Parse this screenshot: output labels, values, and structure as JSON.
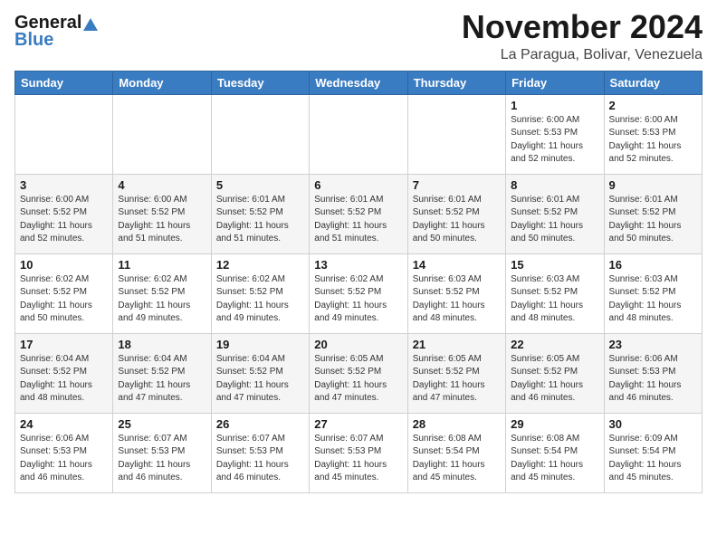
{
  "header": {
    "logo": {
      "general": "General",
      "blue": "Blue"
    },
    "title": "November 2024",
    "location": "La Paragua, Bolivar, Venezuela"
  },
  "weekdays": [
    "Sunday",
    "Monday",
    "Tuesday",
    "Wednesday",
    "Thursday",
    "Friday",
    "Saturday"
  ],
  "weeks": [
    [
      {
        "day": "",
        "info": ""
      },
      {
        "day": "",
        "info": ""
      },
      {
        "day": "",
        "info": ""
      },
      {
        "day": "",
        "info": ""
      },
      {
        "day": "",
        "info": ""
      },
      {
        "day": "1",
        "info": "Sunrise: 6:00 AM\nSunset: 5:53 PM\nDaylight: 11 hours\nand 52 minutes."
      },
      {
        "day": "2",
        "info": "Sunrise: 6:00 AM\nSunset: 5:53 PM\nDaylight: 11 hours\nand 52 minutes."
      }
    ],
    [
      {
        "day": "3",
        "info": "Sunrise: 6:00 AM\nSunset: 5:52 PM\nDaylight: 11 hours\nand 52 minutes."
      },
      {
        "day": "4",
        "info": "Sunrise: 6:00 AM\nSunset: 5:52 PM\nDaylight: 11 hours\nand 51 minutes."
      },
      {
        "day": "5",
        "info": "Sunrise: 6:01 AM\nSunset: 5:52 PM\nDaylight: 11 hours\nand 51 minutes."
      },
      {
        "day": "6",
        "info": "Sunrise: 6:01 AM\nSunset: 5:52 PM\nDaylight: 11 hours\nand 51 minutes."
      },
      {
        "day": "7",
        "info": "Sunrise: 6:01 AM\nSunset: 5:52 PM\nDaylight: 11 hours\nand 50 minutes."
      },
      {
        "day": "8",
        "info": "Sunrise: 6:01 AM\nSunset: 5:52 PM\nDaylight: 11 hours\nand 50 minutes."
      },
      {
        "day": "9",
        "info": "Sunrise: 6:01 AM\nSunset: 5:52 PM\nDaylight: 11 hours\nand 50 minutes."
      }
    ],
    [
      {
        "day": "10",
        "info": "Sunrise: 6:02 AM\nSunset: 5:52 PM\nDaylight: 11 hours\nand 50 minutes."
      },
      {
        "day": "11",
        "info": "Sunrise: 6:02 AM\nSunset: 5:52 PM\nDaylight: 11 hours\nand 49 minutes."
      },
      {
        "day": "12",
        "info": "Sunrise: 6:02 AM\nSunset: 5:52 PM\nDaylight: 11 hours\nand 49 minutes."
      },
      {
        "day": "13",
        "info": "Sunrise: 6:02 AM\nSunset: 5:52 PM\nDaylight: 11 hours\nand 49 minutes."
      },
      {
        "day": "14",
        "info": "Sunrise: 6:03 AM\nSunset: 5:52 PM\nDaylight: 11 hours\nand 48 minutes."
      },
      {
        "day": "15",
        "info": "Sunrise: 6:03 AM\nSunset: 5:52 PM\nDaylight: 11 hours\nand 48 minutes."
      },
      {
        "day": "16",
        "info": "Sunrise: 6:03 AM\nSunset: 5:52 PM\nDaylight: 11 hours\nand 48 minutes."
      }
    ],
    [
      {
        "day": "17",
        "info": "Sunrise: 6:04 AM\nSunset: 5:52 PM\nDaylight: 11 hours\nand 48 minutes."
      },
      {
        "day": "18",
        "info": "Sunrise: 6:04 AM\nSunset: 5:52 PM\nDaylight: 11 hours\nand 47 minutes."
      },
      {
        "day": "19",
        "info": "Sunrise: 6:04 AM\nSunset: 5:52 PM\nDaylight: 11 hours\nand 47 minutes."
      },
      {
        "day": "20",
        "info": "Sunrise: 6:05 AM\nSunset: 5:52 PM\nDaylight: 11 hours\nand 47 minutes."
      },
      {
        "day": "21",
        "info": "Sunrise: 6:05 AM\nSunset: 5:52 PM\nDaylight: 11 hours\nand 47 minutes."
      },
      {
        "day": "22",
        "info": "Sunrise: 6:05 AM\nSunset: 5:52 PM\nDaylight: 11 hours\nand 46 minutes."
      },
      {
        "day": "23",
        "info": "Sunrise: 6:06 AM\nSunset: 5:53 PM\nDaylight: 11 hours\nand 46 minutes."
      }
    ],
    [
      {
        "day": "24",
        "info": "Sunrise: 6:06 AM\nSunset: 5:53 PM\nDaylight: 11 hours\nand 46 minutes."
      },
      {
        "day": "25",
        "info": "Sunrise: 6:07 AM\nSunset: 5:53 PM\nDaylight: 11 hours\nand 46 minutes."
      },
      {
        "day": "26",
        "info": "Sunrise: 6:07 AM\nSunset: 5:53 PM\nDaylight: 11 hours\nand 46 minutes."
      },
      {
        "day": "27",
        "info": "Sunrise: 6:07 AM\nSunset: 5:53 PM\nDaylight: 11 hours\nand 45 minutes."
      },
      {
        "day": "28",
        "info": "Sunrise: 6:08 AM\nSunset: 5:54 PM\nDaylight: 11 hours\nand 45 minutes."
      },
      {
        "day": "29",
        "info": "Sunrise: 6:08 AM\nSunset: 5:54 PM\nDaylight: 11 hours\nand 45 minutes."
      },
      {
        "day": "30",
        "info": "Sunrise: 6:09 AM\nSunset: 5:54 PM\nDaylight: 11 hours\nand 45 minutes."
      }
    ]
  ]
}
